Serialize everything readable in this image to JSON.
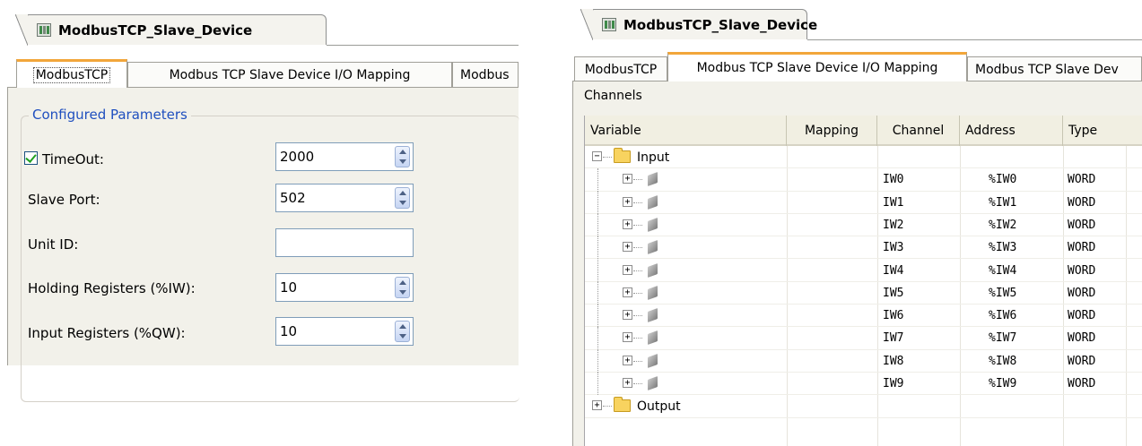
{
  "left": {
    "doc_tab_title": "ModbusTCP_Slave_Device",
    "tabs": [
      "ModbusTCP",
      "Modbus TCP Slave Device I/O Mapping",
      "Modbus"
    ],
    "group_title": "Configured Parameters",
    "params": {
      "timeout": {
        "label": "TimeOut:",
        "value": "2000",
        "checked": true
      },
      "slave_port": {
        "label": "Slave Port:",
        "value": "502"
      },
      "unit_id": {
        "label": "Unit ID:",
        "value": ""
      },
      "holding_registers": {
        "label": "Holding Registers (%IW):",
        "value": "10"
      },
      "input_registers": {
        "label": "Input Registers (%QW):",
        "value": "10"
      }
    }
  },
  "right": {
    "doc_tab_title": "ModbusTCP_Slave_Device",
    "tabs": [
      "ModbusTCP",
      "Modbus TCP Slave Device I/O Mapping",
      "Modbus TCP Slave Dev"
    ],
    "channels_label": "Channels",
    "columns": [
      "Variable",
      "Mapping",
      "Channel",
      "Address",
      "Type"
    ],
    "input_folder": "Input",
    "output_folder": "Output",
    "rows": [
      {
        "channel": "IW0",
        "address": "%IW0",
        "type": "WORD"
      },
      {
        "channel": "IW1",
        "address": "%IW1",
        "type": "WORD"
      },
      {
        "channel": "IW2",
        "address": "%IW2",
        "type": "WORD"
      },
      {
        "channel": "IW3",
        "address": "%IW3",
        "type": "WORD"
      },
      {
        "channel": "IW4",
        "address": "%IW4",
        "type": "WORD"
      },
      {
        "channel": "IW5",
        "address": "%IW5",
        "type": "WORD"
      },
      {
        "channel": "IW6",
        "address": "%IW6",
        "type": "WORD"
      },
      {
        "channel": "IW7",
        "address": "%IW7",
        "type": "WORD"
      },
      {
        "channel": "IW8",
        "address": "%IW8",
        "type": "WORD"
      },
      {
        "channel": "IW9",
        "address": "%IW9",
        "type": "WORD"
      }
    ]
  }
}
